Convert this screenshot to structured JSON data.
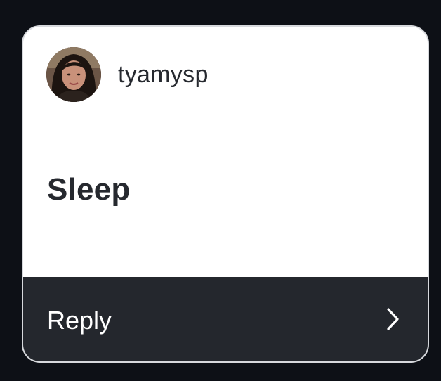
{
  "story": {
    "username": "tyamysp",
    "message": "Sleep",
    "reply_label": "Reply",
    "avatar_icon": "profile-photo",
    "chevron_icon": "chevron-right-icon"
  },
  "colors": {
    "page_background": "#0d1016",
    "card_background": "#ffffff",
    "reply_bar": "#24272d",
    "text_dark": "#26292f",
    "text_light": "#ffffff"
  }
}
